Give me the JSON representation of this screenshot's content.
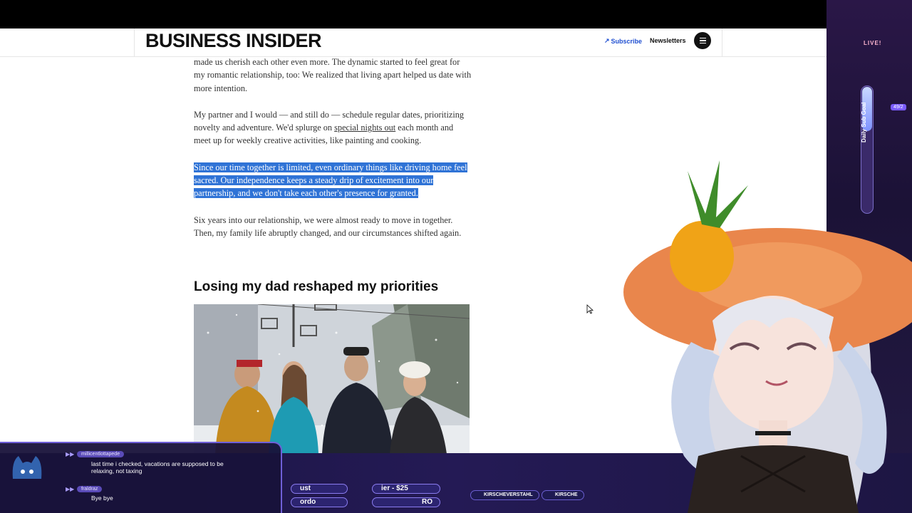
{
  "header": {
    "logo": "BUSINESS INSIDER",
    "subscribe_label": "Subscribe",
    "newsletters_label": "Newsletters"
  },
  "article": {
    "para1": "made us cherish each other even more. The dynamic started to feel great for my romantic relationship, too: We realized that living apart helped us date with more intention.",
    "para2_before": "My partner and I would — and still do — schedule regular dates, prioritizing novelty and adventure. We'd splurge on ",
    "para2_link": "special nights out",
    "para2_after": " each month and meet up for weekly creative activities, like painting and cooking.",
    "para3_highlighted": "Since our time together is limited, even ordinary things like driving home feel sacred. Our independence keeps a steady drip of excitement into our partnership, and we don't take each other's presence for granted.",
    "para4": "Six years into our relationship, we were almost ready to move in together. Then, my family life abruptly changed, and our circumstances shifted again.",
    "subheading": "Losing my dad reshaped my priorities"
  },
  "overlay": {
    "live_label": "LIVE!",
    "sub_goal_label": "Daily Sub Goal",
    "sub_goal_count": "49/2",
    "sub_goal_fraction": 0.35,
    "chat": [
      {
        "user": "millicentlottapede",
        "message": "last time i checked, vacations are supposed to be relaxing, not taxing"
      },
      {
        "user": "fraldraz",
        "message": "Bye bye"
      }
    ],
    "ticker": [
      "ust",
      "ier - $25",
      "ordo",
      "RO"
    ],
    "socials": [
      "KIRSCHEVERSTAHL",
      "KIRSCHE"
    ]
  },
  "colors": {
    "highlight": "#2f73d6",
    "subscribe_link": "#1f4fd1",
    "overlay_purple": "#6f5fd8"
  }
}
